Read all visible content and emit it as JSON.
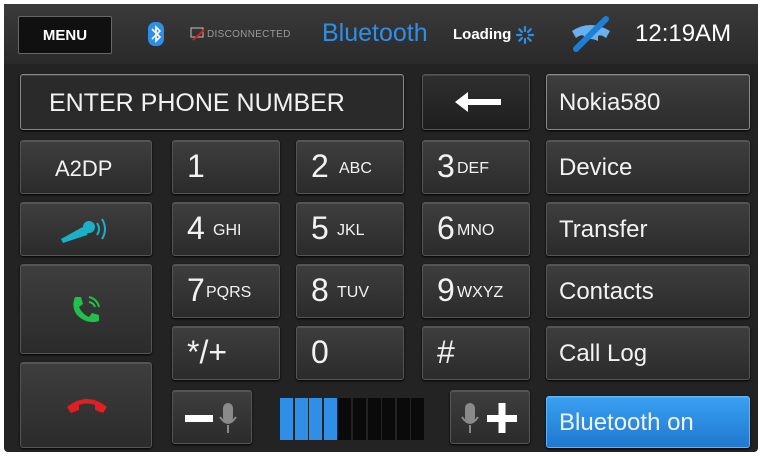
{
  "status_bar": {
    "menu_label": "MENU",
    "bluetooth_icon": "bluetooth-icon",
    "connection_status": "DISCONNECTED",
    "title": "Bluetooth",
    "loading_label": "Loading",
    "time": "12:19AM"
  },
  "entry": {
    "placeholder": "ENTER PHONE NUMBER",
    "backspace_icon": "left-arrow-icon"
  },
  "left_column": {
    "a2dp_label": "A2DP",
    "voice_icon": "voice-dial-icon",
    "answer_icon": "answer-call-icon",
    "hangup_icon": "hang-up-icon"
  },
  "keypad": {
    "k1": {
      "num": "1",
      "sub": ""
    },
    "k2": {
      "num": "2",
      "sub": "ABC"
    },
    "k3": {
      "num": "3",
      "sub": "DEF"
    },
    "k4": {
      "num": "4",
      "sub": "GHI"
    },
    "k5": {
      "num": "5",
      "sub": "JKL"
    },
    "k6": {
      "num": "6",
      "sub": "MNO"
    },
    "k7": {
      "num": "7",
      "sub": "PQRS"
    },
    "k8": {
      "num": "8",
      "sub": "TUV"
    },
    "k9": {
      "num": "9",
      "sub": "WXYZ"
    },
    "kstar": {
      "num": "*/+"
    },
    "k0": {
      "num": "0"
    },
    "khash": {
      "num": "#"
    }
  },
  "volume": {
    "level": 4,
    "max": 10,
    "filled_color": "#2f8fe6",
    "empty_color": "#0a0a0a"
  },
  "right_menu": {
    "device_name": "Nokia580",
    "device": "Device",
    "transfer": "Transfer",
    "contacts": "Contacts",
    "call_log": "Call Log",
    "bluetooth_on": "Bluetooth on"
  },
  "colors": {
    "accent_blue": "#2f8fe6",
    "answer_green": "#22c04a",
    "hangup_red": "#e02020",
    "voice_teal": "#1ab0c8"
  }
}
